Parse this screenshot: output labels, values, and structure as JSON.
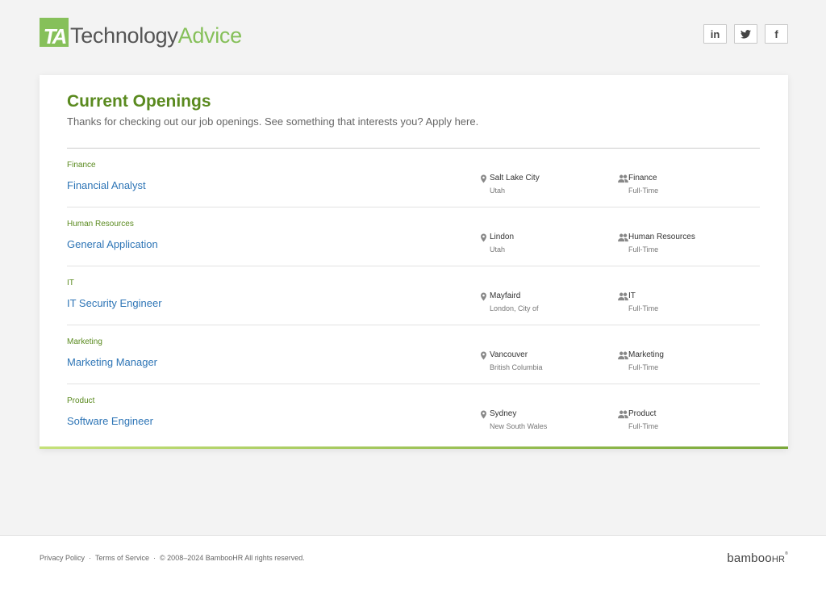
{
  "header": {
    "logo": {
      "mark": "TA",
      "text_primary": "Technology",
      "text_accent": "Advice"
    },
    "social": [
      {
        "icon": "linkedin-icon",
        "label": "in"
      },
      {
        "icon": "twitter-icon",
        "label": "🐦"
      },
      {
        "icon": "facebook-icon",
        "label": "f"
      }
    ]
  },
  "main": {
    "title": "Current Openings",
    "subtitle": "Thanks for checking out our job openings. See something that interests you? Apply here.",
    "jobs": [
      {
        "department": "Finance",
        "title": "Financial Analyst",
        "city": "Salt Lake City",
        "region": "Utah",
        "team": "Finance",
        "employment_type": "Full-Time"
      },
      {
        "department": "Human Resources",
        "title": "General Application",
        "city": "Lindon",
        "region": "Utah",
        "team": "Human Resources",
        "employment_type": "Full-Time"
      },
      {
        "department": "IT",
        "title": "IT Security Engineer",
        "city": "Mayfaird",
        "region": "London, City of",
        "team": "IT",
        "employment_type": "Full-Time"
      },
      {
        "department": "Marketing",
        "title": "Marketing Manager",
        "city": "Vancouver",
        "region": "British Columbia",
        "team": "Marketing",
        "employment_type": "Full-Time"
      },
      {
        "department": "Product",
        "title": "Software Engineer",
        "city": "Sydney",
        "region": "New South Wales",
        "team": "Product",
        "employment_type": "Full-Time"
      }
    ]
  },
  "footer": {
    "privacy": "Privacy Policy",
    "separator": "·",
    "terms": "Terms of Service",
    "copyright": "© 2008–2024 BambooHR All rights reserved.",
    "brand": "bamboo",
    "brand_suffix": "HR",
    "brand_reg": "®"
  },
  "colors": {
    "accent_green": "#5a8a1f",
    "logo_green": "#86c05a",
    "link_blue": "#2e75b6"
  }
}
